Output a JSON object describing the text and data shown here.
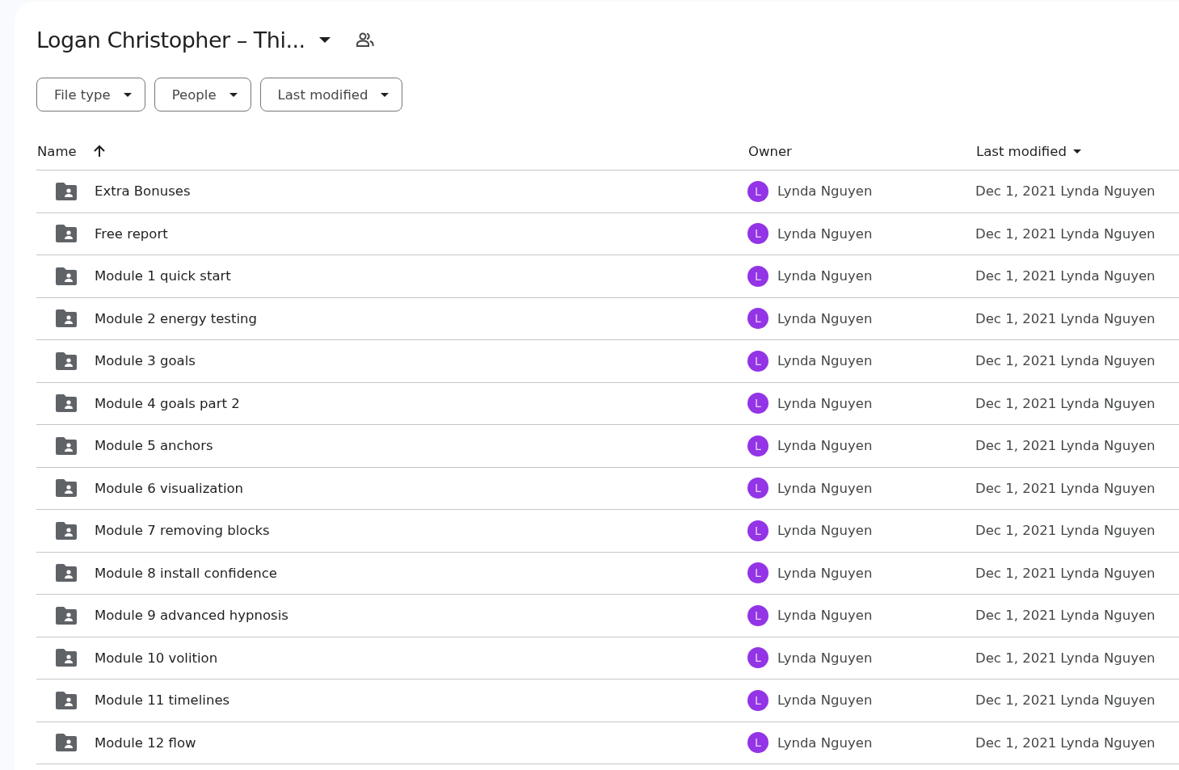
{
  "title": "Logan Christopher – Thi...",
  "filters": [
    {
      "label": "File type"
    },
    {
      "label": "People"
    },
    {
      "label": "Last modified"
    }
  ],
  "columns": {
    "name": "Name",
    "owner": "Owner",
    "modified": "Last modified"
  },
  "rows": [
    {
      "name": "Extra Bonuses",
      "avatar": "L",
      "owner": "Lynda Nguyen",
      "modified": "Dec 1, 2021",
      "modified_by": "Lynda Nguyen"
    },
    {
      "name": "Free report",
      "avatar": "L",
      "owner": "Lynda Nguyen",
      "modified": "Dec 1, 2021",
      "modified_by": "Lynda Nguyen"
    },
    {
      "name": "Module 1 quick start",
      "avatar": "L",
      "owner": "Lynda Nguyen",
      "modified": "Dec 1, 2021",
      "modified_by": "Lynda Nguyen"
    },
    {
      "name": "Module 2 energy testing",
      "avatar": "L",
      "owner": "Lynda Nguyen",
      "modified": "Dec 1, 2021",
      "modified_by": "Lynda Nguyen"
    },
    {
      "name": "Module 3 goals",
      "avatar": "L",
      "owner": "Lynda Nguyen",
      "modified": "Dec 1, 2021",
      "modified_by": "Lynda Nguyen"
    },
    {
      "name": "Module 4 goals part 2",
      "avatar": "L",
      "owner": "Lynda Nguyen",
      "modified": "Dec 1, 2021",
      "modified_by": "Lynda Nguyen"
    },
    {
      "name": "Module 5 anchors",
      "avatar": "L",
      "owner": "Lynda Nguyen",
      "modified": "Dec 1, 2021",
      "modified_by": "Lynda Nguyen"
    },
    {
      "name": "Module 6 visualization",
      "avatar": "L",
      "owner": "Lynda Nguyen",
      "modified": "Dec 1, 2021",
      "modified_by": "Lynda Nguyen"
    },
    {
      "name": "Module 7 removing blocks",
      "avatar": "L",
      "owner": "Lynda Nguyen",
      "modified": "Dec 1, 2021",
      "modified_by": "Lynda Nguyen"
    },
    {
      "name": "Module 8 install confidence",
      "avatar": "L",
      "owner": "Lynda Nguyen",
      "modified": "Dec 1, 2021",
      "modified_by": "Lynda Nguyen"
    },
    {
      "name": "Module 9 advanced hypnosis",
      "avatar": "L",
      "owner": "Lynda Nguyen",
      "modified": "Dec 1, 2021",
      "modified_by": "Lynda Nguyen"
    },
    {
      "name": "Module 10 volition",
      "avatar": "L",
      "owner": "Lynda Nguyen",
      "modified": "Dec 1, 2021",
      "modified_by": "Lynda Nguyen"
    },
    {
      "name": "Module 11 timelines",
      "avatar": "L",
      "owner": "Lynda Nguyen",
      "modified": "Dec 1, 2021",
      "modified_by": "Lynda Nguyen"
    },
    {
      "name": "Module 12 flow",
      "avatar": "L",
      "owner": "Lynda Nguyen",
      "modified": "Dec 1, 2021",
      "modified_by": "Lynda Nguyen"
    }
  ]
}
